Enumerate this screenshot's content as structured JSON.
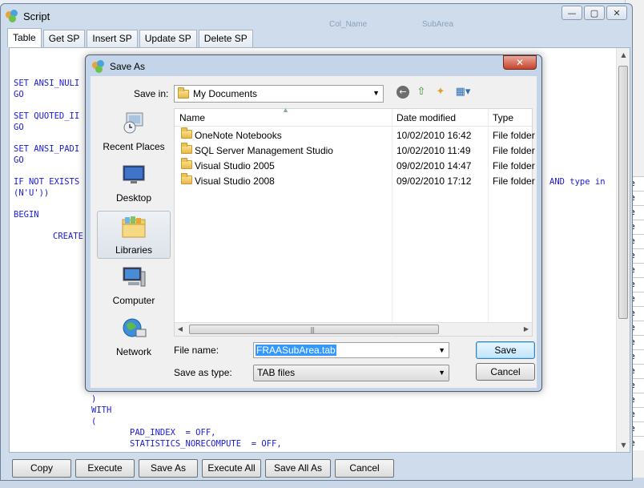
{
  "script_window": {
    "title": "Script",
    "faded_header_left": "Col_Name",
    "faded_header_right": "SubArea",
    "controls": [
      "minimize",
      "maximize",
      "close"
    ],
    "tabs": [
      "Table",
      "Get SP",
      "Insert SP",
      "Update SP",
      "Delete SP"
    ],
    "active_tab": "Table",
    "code": {
      "l1": "SET ANSI_NULI",
      "l2": "GO",
      "l3": "SET QUOTED_II",
      "l4": "GO",
      "l5": "SET ANSI_PADI",
      "l6": "GO",
      "l7": "IF NOT EXISTS",
      "l7b": "AND type in",
      "l8": "(N'U'))",
      "l9": "BEGIN",
      "l10": "CREATE",
      "l11": ")",
      "l12": "WITH",
      "l13": "(",
      "l14": "PAD_INDEX  = OFF,",
      "l15": "STATISTICS_NORECOMPUTE  = OFF,"
    },
    "buttons": {
      "copy": "Copy",
      "execute": "Execute",
      "save_as": "Save As",
      "execute_all": "Execute All",
      "save_all_as": "Save All As",
      "cancel": "Cancel"
    }
  },
  "save_dialog": {
    "title": "Save As",
    "save_in_label": "Save in:",
    "save_in_value": "My Documents",
    "places": [
      "Recent Places",
      "Desktop",
      "Libraries",
      "Computer",
      "Network"
    ],
    "selected_place": "Libraries",
    "columns": {
      "name": "Name",
      "date": "Date modified",
      "type": "Type"
    },
    "files": [
      {
        "name": "OneNote Notebooks",
        "date": "10/02/2010 16:42",
        "type": "File folder"
      },
      {
        "name": "SQL Server Management Studio",
        "date": "10/02/2010 11:49",
        "type": "File folder"
      },
      {
        "name": "Visual Studio 2005",
        "date": "09/02/2010 14:47",
        "type": "File folder"
      },
      {
        "name": "Visual Studio 2008",
        "date": "09/02/2010 17:12",
        "type": "File folder"
      }
    ],
    "file_name_label": "File name:",
    "file_name_value": "FRAASubArea.tab",
    "save_type_label": "Save as type:",
    "save_type_value": "TAB files",
    "save_button": "Save",
    "cancel_button": "Cancel"
  },
  "background_cells": [
    "e",
    "e",
    "e",
    "e",
    "e",
    "e",
    "e",
    "e",
    "e",
    "e",
    "e",
    "e",
    "e",
    "e",
    "e",
    "e",
    "e",
    "e",
    "e"
  ],
  "colors": {
    "code_blue": "#1a1ad8",
    "selection": "#3399ff",
    "close_red": "#c7432a"
  }
}
